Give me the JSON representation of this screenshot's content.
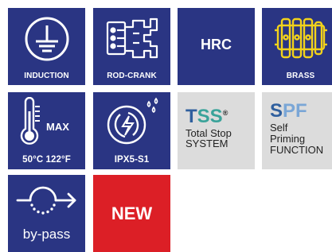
{
  "tiles": {
    "induction": {
      "label": "INDUCTION",
      "icon": "ground-symbol-icon"
    },
    "rod_crank": {
      "label": "ROD-CRANK",
      "icon": "crankshaft-icon"
    },
    "hrc": {
      "label": "HRC"
    },
    "brass": {
      "label": "BRASS",
      "icon": "brass-manifold-icon"
    },
    "max_temp": {
      "max": "MAX",
      "label": "50°C 122°F",
      "icon": "thermometer-icon"
    },
    "ipx": {
      "label": "IPX5-S1",
      "icon": "water-protection-icon"
    },
    "tss": {
      "t": "T",
      "ss": "SS",
      "reg": "®",
      "line1": "Total Stop",
      "line2": "SYSTEM"
    },
    "spf": {
      "s": "S",
      "pf": "PF",
      "line1": "Self",
      "line2": "Priming",
      "line3": "FUNCTION"
    },
    "bypass": {
      "label": "by-pass",
      "icon": "bypass-arrow-icon"
    },
    "new": {
      "label": "NEW"
    }
  },
  "colors": {
    "navy": "#2a3583",
    "red": "#dc1f26",
    "gray": "#dcdcdc",
    "yellow": "#f2d21b"
  }
}
